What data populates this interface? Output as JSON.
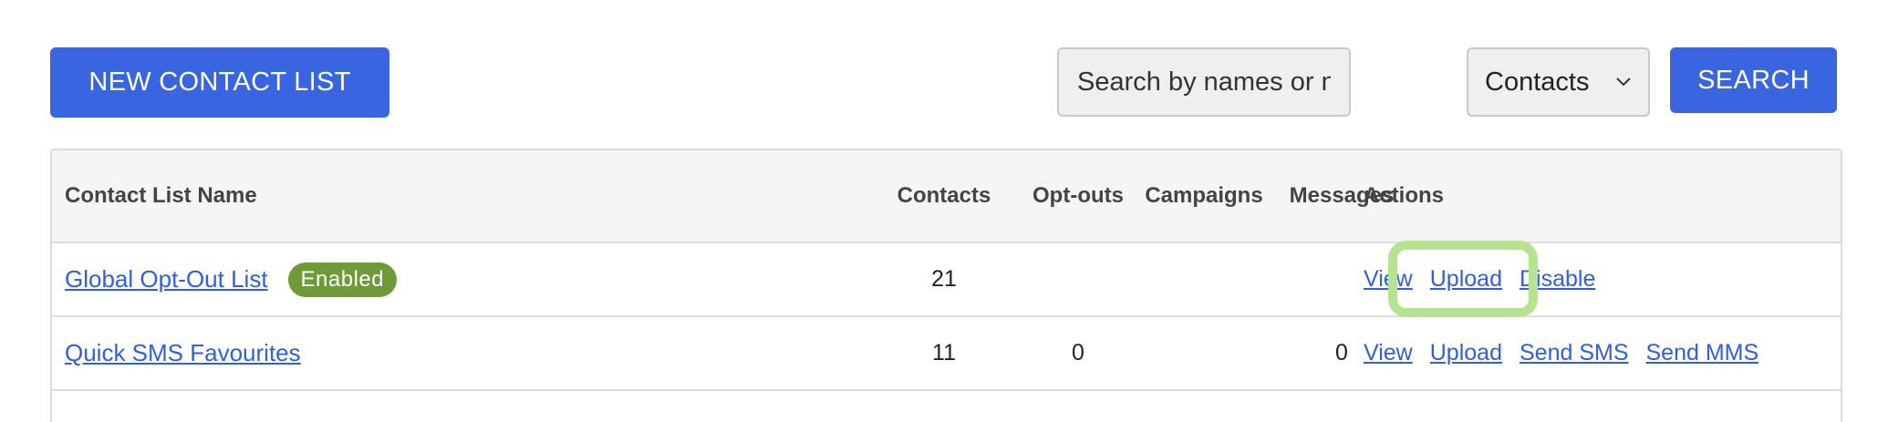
{
  "toolbar": {
    "new_list_label": "NEW CONTACT LIST",
    "search_placeholder": "Search by names or numbers...",
    "search_value": "",
    "filter_selected": "Contacts",
    "search_label": "SEARCH"
  },
  "table": {
    "headers": {
      "name": "Contact List Name",
      "contacts": "Contacts",
      "optouts": "Opt-outs",
      "campaigns": "Campaigns",
      "messages": "Messages",
      "actions": "Actions"
    },
    "rows": [
      {
        "name": "Global Opt-Out List",
        "badge": "Enabled",
        "contacts": "21",
        "optouts": "",
        "campaigns": "",
        "messages": "",
        "actions": [
          "View",
          "Upload",
          "Disable"
        ]
      },
      {
        "name": "Quick SMS Favourites",
        "badge": "",
        "contacts": "11",
        "optouts": "0",
        "campaigns": "",
        "messages": "0",
        "actions": [
          "View",
          "Upload",
          "Send SMS",
          "Send MMS"
        ]
      }
    ]
  },
  "colors": {
    "primary": "#3966e0",
    "badge": "#6e9a37",
    "highlight": "#b5e38f",
    "link": "#2f5fe0"
  }
}
